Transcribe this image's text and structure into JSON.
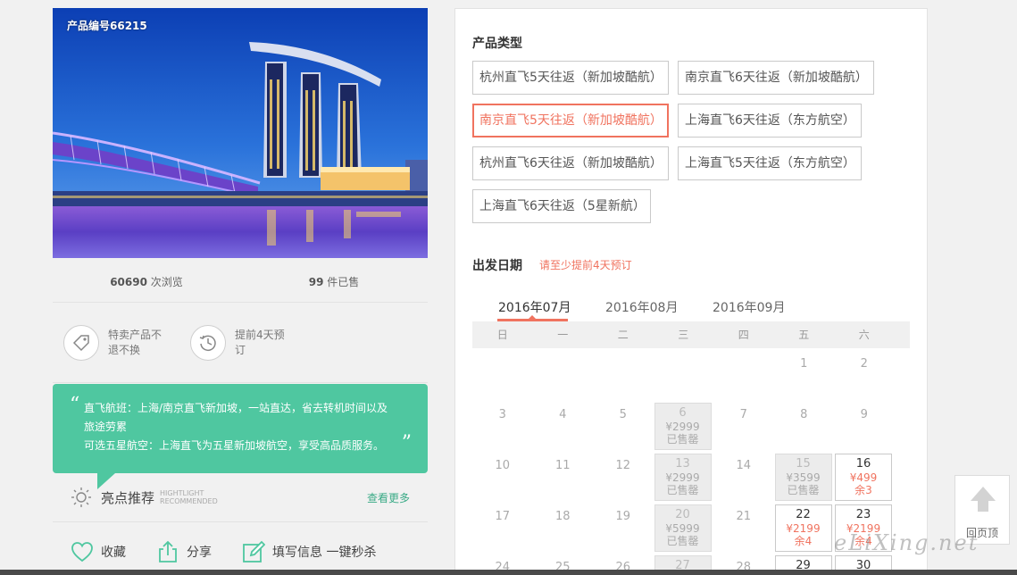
{
  "product": {
    "id_label": "产品编号66215",
    "views_num": "60690",
    "views_label": " 次浏览",
    "sold_num": "99",
    "sold_label": " 件已售"
  },
  "features": [
    {
      "icon": "tag-icon",
      "text": "特卖产品不退不换"
    },
    {
      "icon": "clock-icon",
      "text": "提前4天预订"
    }
  ],
  "bubble": {
    "line1": "直飞航班：上海/南京直飞新加坡，一站直达，省去转机时间以及旅途劳累",
    "line2": "可选五星航空：上海直飞为五星新加坡航空，享受高品质服务。"
  },
  "highlight": {
    "title": "亮点推荐",
    "en1": "HIGHTLIGHT",
    "en2": "RECOMMENDED",
    "more": "查看更多"
  },
  "actions": {
    "favorite": "收藏",
    "share": "分享",
    "fill": "填写信息 一键秒杀"
  },
  "product_types": {
    "title": "产品类型",
    "items": [
      "杭州直飞5天往返（新加坡酷航）",
      "南京直飞6天往返（新加坡酷航）",
      "南京直飞5天往返（新加坡酷航）",
      "上海直飞6天往返（东方航空）",
      "杭州直飞6天往返（新加坡酷航）",
      "上海直飞5天往返（东方航空）",
      "上海直飞6天往返（5星新航）"
    ],
    "active_index": 2
  },
  "departure": {
    "title": "出发日期",
    "tip": "请至少提前4天预订"
  },
  "months": [
    "2016年07月",
    "2016年08月",
    "2016年09月"
  ],
  "active_month": 0,
  "weekdays": [
    "日",
    "一",
    "二",
    "三",
    "四",
    "五",
    "六"
  ],
  "calendar": [
    [
      {
        "d": ""
      },
      {
        "d": ""
      },
      {
        "d": ""
      },
      {
        "d": ""
      },
      {
        "d": ""
      },
      {
        "d": "1"
      },
      {
        "d": "2"
      }
    ],
    [
      {
        "d": "3"
      },
      {
        "d": "4"
      },
      {
        "d": "5"
      },
      {
        "d": "6",
        "status": "sold",
        "price": "¥2999",
        "note": "已售罄"
      },
      {
        "d": "7"
      },
      {
        "d": "8"
      },
      {
        "d": "9"
      }
    ],
    [
      {
        "d": "10"
      },
      {
        "d": "11"
      },
      {
        "d": "12"
      },
      {
        "d": "13",
        "status": "sold",
        "price": "¥2999",
        "note": "已售罄"
      },
      {
        "d": "14"
      },
      {
        "d": "15",
        "status": "sold",
        "price": "¥3599",
        "note": "已售罄"
      },
      {
        "d": "16",
        "status": "avail",
        "price": "¥499",
        "note": "余3"
      }
    ],
    [
      {
        "d": "17"
      },
      {
        "d": "18"
      },
      {
        "d": "19"
      },
      {
        "d": "20",
        "status": "sold",
        "price": "¥5999",
        "note": "已售罄"
      },
      {
        "d": "21"
      },
      {
        "d": "22",
        "status": "avail",
        "price": "¥2199",
        "note": "余4"
      },
      {
        "d": "23",
        "status": "avail",
        "price": "¥2199",
        "note": "余4"
      }
    ],
    [
      {
        "d": "24"
      },
      {
        "d": "25"
      },
      {
        "d": "26"
      },
      {
        "d": "27",
        "status": "sold",
        "price": "",
        "note": ""
      },
      {
        "d": "28"
      },
      {
        "d": "29",
        "status": "avail",
        "price": "",
        "note": ""
      },
      {
        "d": "30",
        "status": "avail",
        "price": "",
        "note": ""
      }
    ]
  ],
  "back_to_top": "回页顶",
  "watermark": "eLiXing.net",
  "colors": {
    "accent": "#f0735f",
    "green": "#4fc7a0"
  }
}
